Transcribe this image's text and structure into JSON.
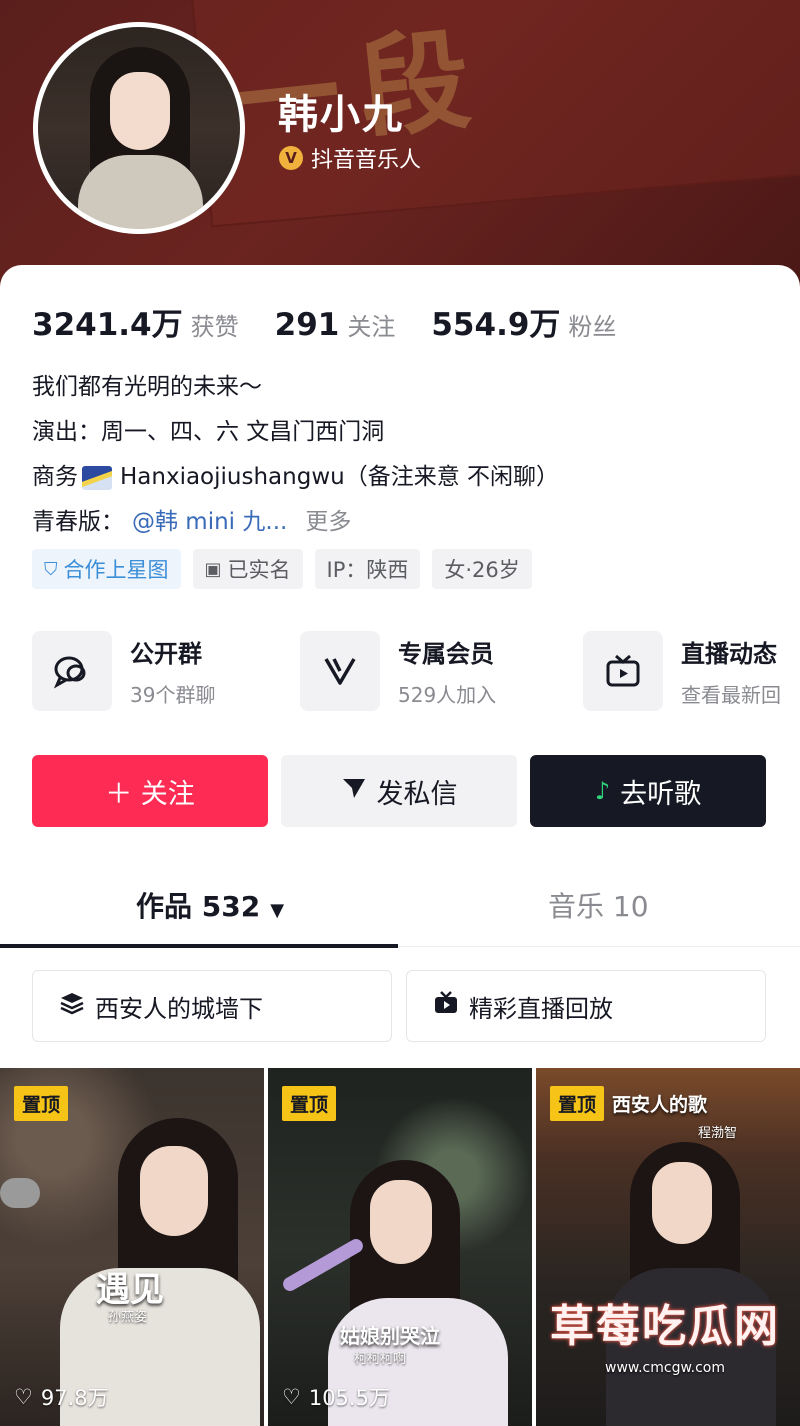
{
  "profile": {
    "name": "韩小九",
    "verify_label": "抖音音乐人",
    "banner_text": "一段"
  },
  "stats": [
    {
      "value": "3241.4万",
      "label": "获赞"
    },
    {
      "value": "291",
      "label": "关注"
    },
    {
      "value": "554.9万",
      "label": "粉丝"
    }
  ],
  "bio": {
    "line1": "我们都有光明的未来～",
    "line2": "演出：周一、四、六 文昌门西门洞",
    "line3_prefix": "商务",
    "line3_rest": "Hanxiaojiushangwu（备注来意 不闲聊）",
    "line4_prefix": "青春版：",
    "line4_mention": "@韩 mini 九...",
    "more": "更多"
  },
  "tags": [
    {
      "label": "合作上星图",
      "icon": "star-map-icon"
    },
    {
      "label": "已实名",
      "icon": "id-card-icon"
    },
    {
      "label": "IP：陕西"
    },
    {
      "label": "女·26岁"
    }
  ],
  "features": [
    {
      "title": "公开群",
      "sub": "39个群聊",
      "icon": "chat-bubbles-icon"
    },
    {
      "title": "专属会员",
      "sub": "529人加入",
      "icon": "v-member-icon"
    },
    {
      "title": "直播动态",
      "sub": "查看最新回",
      "icon": "tv-live-icon"
    }
  ],
  "actions": {
    "follow": "＋ 关注",
    "message": "发私信",
    "listen": "去听歌"
  },
  "tabs": {
    "works": "作品 532",
    "music": "音乐 10"
  },
  "collections": [
    {
      "label": "西安人的城墙下",
      "icon": "stack-icon"
    },
    {
      "label": "精彩直播回放",
      "icon": "live-replay-icon"
    }
  ],
  "videos": [
    {
      "pin": "置顶",
      "likes": "97.8万",
      "title": "遇见",
      "singer": "孙燕姿"
    },
    {
      "pin": "置顶",
      "likes": "105.5万",
      "title": "姑娘别哭泣",
      "singer": "柯柯柯啊"
    },
    {
      "pin": "置顶",
      "likes": "",
      "title": "西安人的歌",
      "singer": "程渤智"
    }
  ],
  "watermark": {
    "big": "草莓吃瓜网",
    "small": "www.cmcgw.com"
  },
  "colors": {
    "accent": "#fe2c55",
    "banner": "#5a1f1c",
    "pin": "#f5c416",
    "link": "#3a6bb8"
  }
}
